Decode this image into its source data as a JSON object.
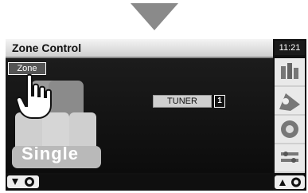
{
  "header": {
    "title": "Zone Control",
    "clock": "11:21"
  },
  "zone": {
    "button_label": "Zone",
    "source_label": "TUNER",
    "callout_number": "1",
    "mode_label": "Single"
  },
  "colors": {
    "screen_bg": "#111111",
    "titlebar_bg": "#d8d8d8",
    "accent": "#ffffff"
  },
  "icons": {
    "top": "down-arrow-icon",
    "side": [
      "equalizer-icon",
      "audio-fx-icon",
      "speaker-icon",
      "settings-icon"
    ],
    "hand": "hand-pointer-icon",
    "volume_down": "volume-down-icon",
    "volume_up": "volume-up-icon"
  }
}
